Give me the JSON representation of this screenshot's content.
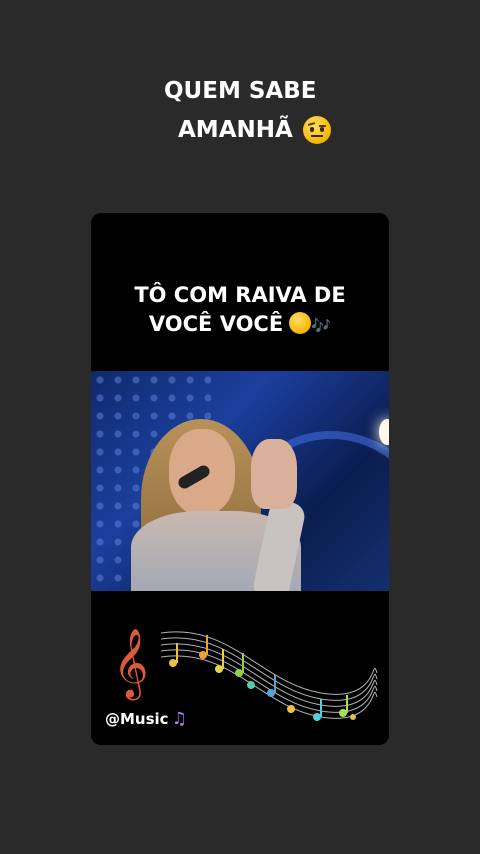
{
  "story": {
    "line1": "QUEM SABE",
    "line2": "AMANHÃ",
    "line2_emoji": "raised-eyebrow-face-icon"
  },
  "post": {
    "caption_line1": "TÔ COM RAIVA DE",
    "caption_line2": "VOCÊ VOCÊ",
    "caption_emoji": "smirking-face-icon",
    "caption_notes": "🎶",
    "handle": "@Music",
    "handle_icon": "music-note-icon",
    "music_graphic": "treble-clef-staff-notes-icon"
  },
  "colors": {
    "background": "#2b2a2a",
    "card": "#000000",
    "text": "#ffffff"
  }
}
